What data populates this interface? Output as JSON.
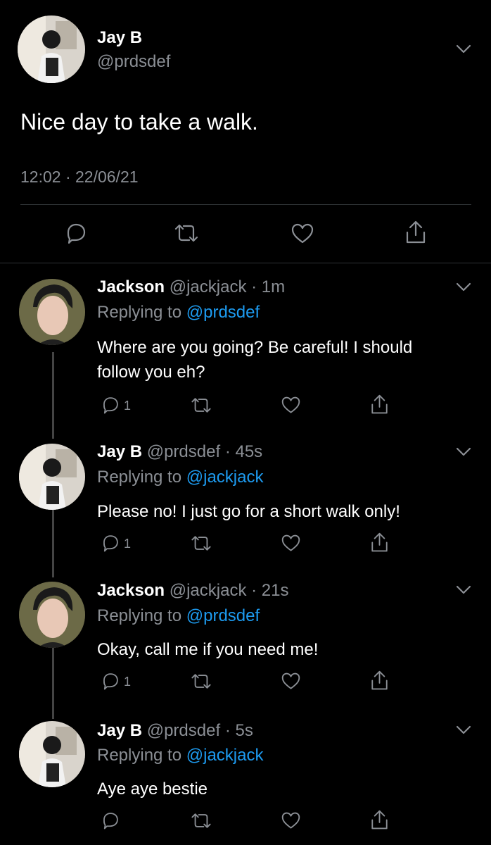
{
  "main_tweet": {
    "name": "Jay B",
    "handle": "@prdsdef",
    "text": "Nice day to take a walk.",
    "timestamp": "12:02 · 22/06/21"
  },
  "replies": [
    {
      "name": "Jackson",
      "handle": "@jackjack",
      "time": "· 1m",
      "replying_prefix": "Replying to",
      "replying_to": "@prdsdef",
      "text_lines": [
        "Where are you going? Be careful! I should",
        "follow you eh?"
      ],
      "reply_count": "1"
    },
    {
      "name": "Jay B",
      "handle": "@prdsdef",
      "time": "· 45s",
      "replying_prefix": "Replying to",
      "replying_to": "@jackjack",
      "text_lines": [
        "Please no! I just go for a short walk only!"
      ],
      "reply_count": "1"
    },
    {
      "name": "Jackson",
      "handle": "@jackjack",
      "time": "· 21s",
      "replying_prefix": "Replying to",
      "replying_to": "@prdsdef",
      "text_lines": [
        "Okay, call me if you need me!"
      ],
      "reply_count": "1"
    },
    {
      "name": "Jay B",
      "handle": "@prdsdef",
      "time": "· 5s",
      "replying_prefix": "Replying to",
      "replying_to": "@jackjack",
      "text_lines": [
        "Aye aye bestie"
      ],
      "reply_count": ""
    }
  ],
  "icons": [
    "chevron-down-icon",
    "reply-icon",
    "retweet-icon",
    "like-icon",
    "share-icon"
  ],
  "colors": {
    "background": "#000000",
    "text": "#ffffff",
    "muted": "#8b8f95",
    "link": "#1d9bf0"
  }
}
